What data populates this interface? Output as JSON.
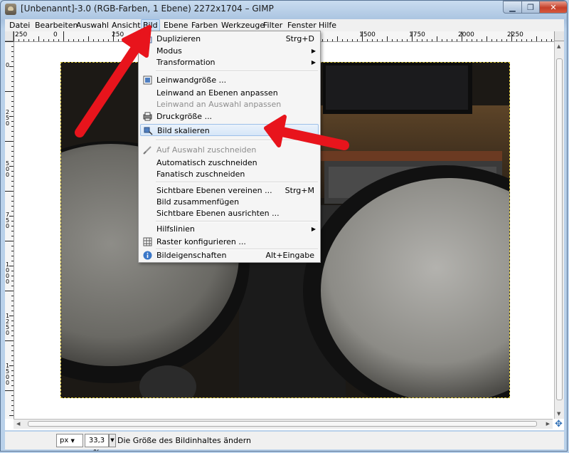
{
  "window": {
    "title": "[Unbenannt]-3.0 (RGB-Farben, 1 Ebene) 2272x1704 – GIMP",
    "controls": {
      "minimize": "▁",
      "maximize": "❐",
      "close": "✕"
    }
  },
  "menubar": {
    "items": [
      {
        "label": "Datei"
      },
      {
        "label": "Bearbeiten"
      },
      {
        "label": "Auswahl"
      },
      {
        "label": "Ansicht"
      },
      {
        "label": "Bild"
      },
      {
        "label": "Ebene"
      },
      {
        "label": "Farben"
      },
      {
        "label": "Werkzeuge"
      },
      {
        "label": "Filter"
      },
      {
        "label": "Fenster"
      },
      {
        "label": "Hilfe"
      }
    ],
    "active": "Bild"
  },
  "bild_menu": {
    "items": [
      {
        "label": "Duplizieren",
        "shortcut": "Strg+D",
        "icon": "duplicate-icon"
      },
      {
        "label": "Modus",
        "submenu": "▶"
      },
      {
        "label": "Transformation",
        "submenu": "▶"
      },
      {
        "label": "Leinwandgröße ...",
        "icon": "canvas-size-icon"
      },
      {
        "label": "Leinwand an Ebenen anpassen"
      },
      {
        "label": "Leinwand an Auswahl anpassen",
        "disabled": true
      },
      {
        "label": "Druckgröße ...",
        "icon": "print-size-icon"
      },
      {
        "label": "Bild skalieren",
        "icon": "scale-image-icon",
        "highlighted": true
      },
      {
        "label": "Auf Auswahl zuschneiden",
        "icon": "crop-icon",
        "disabled": true
      },
      {
        "label": "Automatisch zuschneiden"
      },
      {
        "label": "Fanatisch zuschneiden"
      },
      {
        "label": "Sichtbare Ebenen vereinen ...",
        "shortcut": "Strg+M"
      },
      {
        "label": "Bild zusammenfügen"
      },
      {
        "label": "Sichtbare Ebenen ausrichten ..."
      },
      {
        "label": "Hilfslinien",
        "submenu": "▶"
      },
      {
        "label": "Raster konfigurieren ...",
        "icon": "grid-icon"
      },
      {
        "label": "Bildeigenschaften",
        "shortcut": "Alt+Eingabe",
        "icon": "info-icon"
      }
    ]
  },
  "rulers": {
    "horizontal": [
      "250",
      "0",
      "250",
      "1500",
      "1750",
      "2000",
      "2250"
    ],
    "vertical": [
      "0",
      "250",
      "500",
      "750",
      "1000",
      "1250",
      "1500"
    ]
  },
  "statusbar": {
    "unit": "px",
    "zoom": "33,3 %",
    "message": "Die Größe des Bildinhaltes ändern"
  },
  "colors": {
    "arrow": "#e8141c",
    "menu_highlight": "#d6e6f8"
  }
}
